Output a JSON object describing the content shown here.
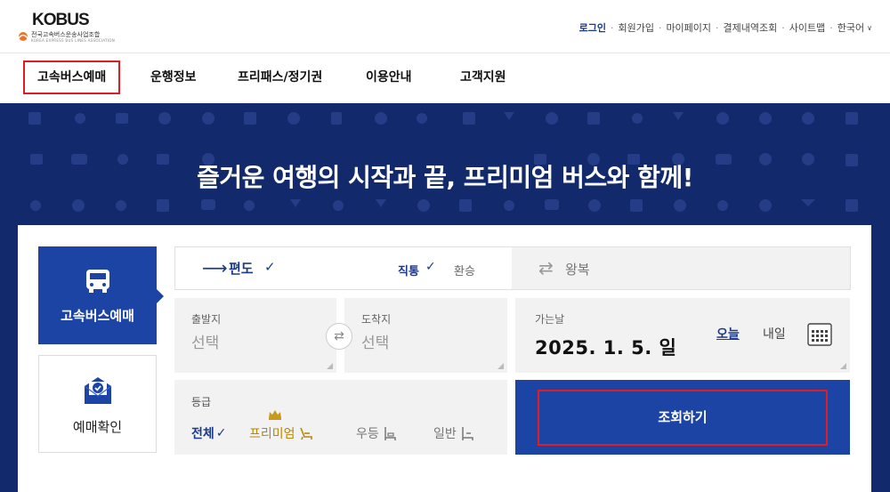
{
  "header": {
    "logo": {
      "wordmark": "KOBUS",
      "org_name": "전국고속버스운송사업조합",
      "org_name_en": "KOREA EXPRESS BUS LINES ASSOCIATION"
    },
    "util_links": [
      {
        "label": "로그인"
      },
      {
        "label": "회원가입"
      },
      {
        "label": "마이페이지"
      },
      {
        "label": "결제내역조회"
      },
      {
        "label": "사이트맵"
      },
      {
        "label": "한국어"
      }
    ]
  },
  "gnb": {
    "items": [
      {
        "label": "고속버스예매",
        "active": true
      },
      {
        "label": "운행정보"
      },
      {
        "label": "프리패스/정기권"
      },
      {
        "label": "이용안내"
      },
      {
        "label": "고객지원"
      }
    ]
  },
  "hero": {
    "headline": "즐거운 여행의 시작과 끝, 프리미엄 버스와 함께!"
  },
  "booking": {
    "side_tabs": {
      "book": "고속버스예매",
      "check": "예매확인"
    },
    "trip_type": {
      "oneway": "편도",
      "oneway_check": "✓",
      "direct": "직통",
      "direct_check": "✓",
      "transfer": "환승",
      "roundtrip": "왕복"
    },
    "departure": {
      "label": "출발지",
      "value": "선택"
    },
    "arrival": {
      "label": "도착지",
      "value": "선택"
    },
    "date": {
      "label": "가는날",
      "value": "2025. 1. 5. 일",
      "today": "오늘",
      "tomorrow": "내일"
    },
    "grade": {
      "label": "등급",
      "options": [
        "전체",
        "프리미엄",
        "우등",
        "일반"
      ],
      "selected_check": "✓"
    },
    "search_button": "조회하기"
  },
  "colors": {
    "hero_bg": "#12296b",
    "primary_blue": "#1c44a5",
    "highlight_red": "#e21c23",
    "premium_gold": "#b8860b"
  }
}
